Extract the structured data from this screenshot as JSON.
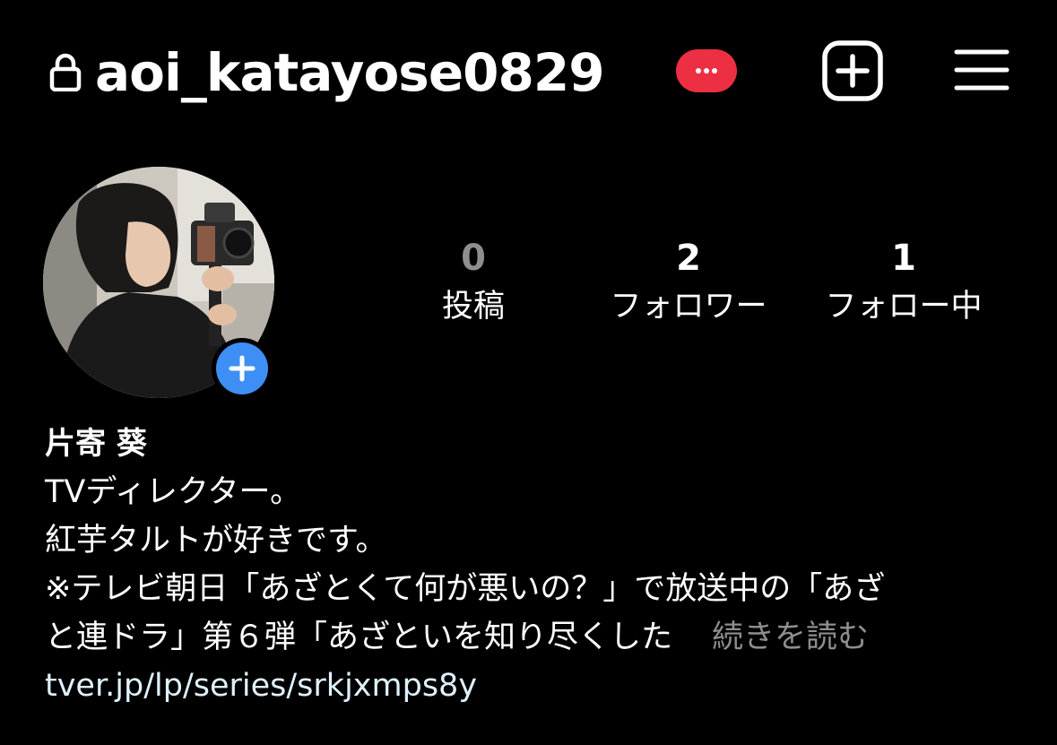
{
  "header": {
    "username": "aoi_katayose0829",
    "badge_color": "#ed2f43",
    "lock_icon": "lock-icon",
    "create_icon": "plus-square-icon",
    "menu_icon": "hamburger-menu-icon"
  },
  "avatar": {
    "add_story_color": "#3d8ff5",
    "add_story_icon": "plus-icon"
  },
  "stats": [
    {
      "value": "0",
      "label": "投稿"
    },
    {
      "value": "2",
      "label": "フォロワー"
    },
    {
      "value": "1",
      "label": "フォロー中"
    }
  ],
  "bio": {
    "name": "片寄 葵",
    "lines": [
      "TVディレクター。",
      "紅芋タルトが好きです。",
      "※テレビ朝日「あざとくて何が悪いの？」で放送中の「あざ",
      "と連ドラ」第６弾「あざといを知り尽くした"
    ],
    "more_label": "続きを読む",
    "link": "tver.jp/lp/series/srkjxmps8y"
  }
}
